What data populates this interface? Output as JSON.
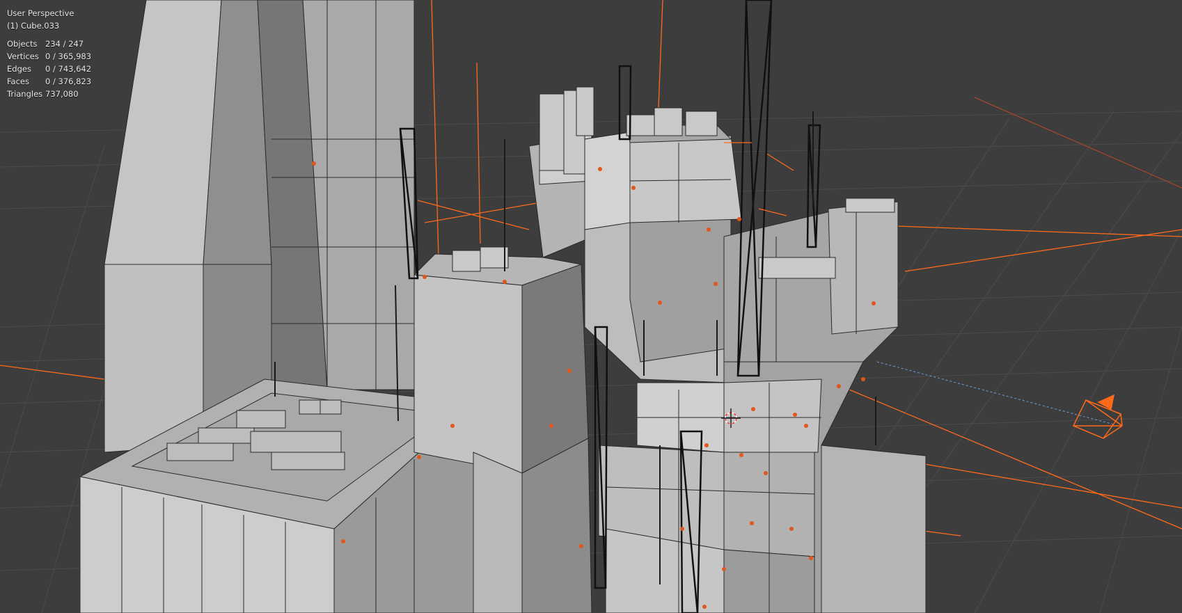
{
  "viewport": {
    "view_name": "User Perspective",
    "active_object": "(1) Cube.033"
  },
  "stats": [
    {
      "label": "Objects",
      "value": "234 / 247"
    },
    {
      "label": "Vertices",
      "value": "0 / 365,983"
    },
    {
      "label": "Edges",
      "value": "0 / 743,642"
    },
    {
      "label": "Faces",
      "value": "0 / 376,823"
    },
    {
      "label": "Triangles",
      "value": "737,080"
    }
  ],
  "colors": {
    "background": "#3d3d3d",
    "grid": "#4a4a4a",
    "mesh_light": "#c2c2c2",
    "mesh_mid": "#a6a6a6",
    "mesh_dark": "#6e6e6e",
    "wire": "#2a2a2a",
    "selection_orange": "#ff6a1a",
    "origin_dot": "#e2561c"
  },
  "icons": {
    "camera": "camera-icon",
    "cursor": "3d-cursor-icon"
  }
}
